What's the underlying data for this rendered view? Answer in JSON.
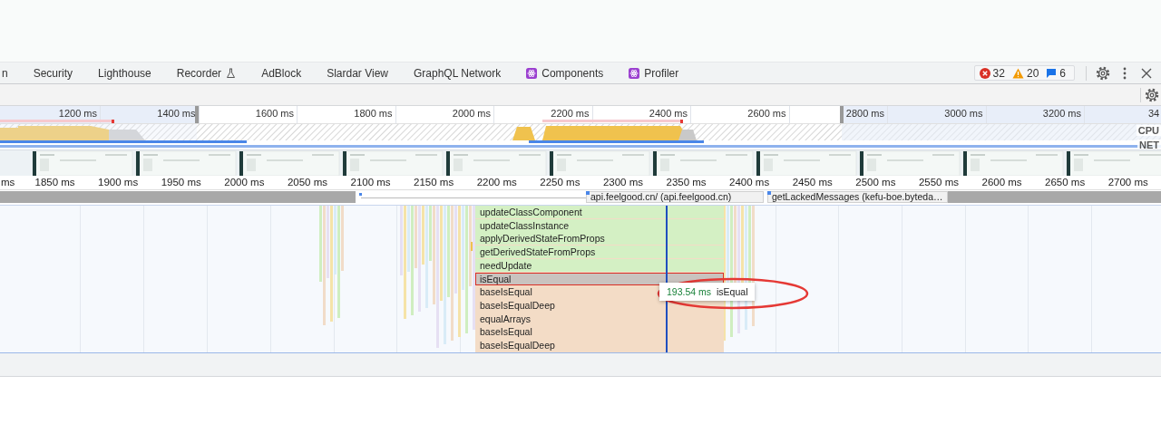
{
  "tabs": [
    {
      "label": "n",
      "selected": false
    },
    {
      "label": "Security",
      "selected": false
    },
    {
      "label": "Lighthouse",
      "selected": false
    },
    {
      "label": "Recorder",
      "selected": false
    },
    {
      "label": "AdBlock",
      "selected": false
    },
    {
      "label": "Slardar View",
      "selected": false
    },
    {
      "label": "GraphQL Network",
      "selected": false
    },
    {
      "label": "Components",
      "selected": false
    },
    {
      "label": "Profiler",
      "selected": false
    }
  ],
  "counters": [
    {
      "kind": "error",
      "count": "32"
    },
    {
      "kind": "warning",
      "count": "20"
    },
    {
      "kind": "info",
      "count": "6"
    }
  ],
  "overview": {
    "ticks": [
      "1200 ms",
      "1400 ms",
      "1600 ms",
      "1800 ms",
      "2000 ms",
      "2200 ms",
      "2400 ms",
      "2600 ms",
      "2800 ms",
      "3000 ms",
      "3200 ms",
      "34"
    ],
    "track_labels": [
      "CPU",
      "NET"
    ]
  },
  "detail_ruler": {
    "ticks": [
      "ms",
      "1850 ms",
      "1900 ms",
      "1950 ms",
      "2000 ms",
      "2050 ms",
      "2100 ms",
      "2150 ms",
      "2200 ms",
      "2250 ms",
      "2300 ms",
      "2350 ms",
      "2400 ms",
      "2450 ms",
      "2500 ms",
      "2550 ms",
      "2600 ms",
      "2650 ms",
      "2700 ms"
    ]
  },
  "network_requests": [
    {
      "label": "api.feelgood.cn/ (api.feelgood.cn)"
    },
    {
      "label": "getLackedMessages (kefu-boe.byteda…"
    }
  ],
  "flame_chart": {
    "entries": [
      {
        "name": "updateClassComponent",
        "color": "#d4f0c4",
        "selected": false
      },
      {
        "name": "updateClassInstance",
        "color": "#d4f0c4",
        "selected": false
      },
      {
        "name": "applyDerivedStateFromProps",
        "color": "#d4f0c4",
        "selected": false
      },
      {
        "name": "getDerivedStateFromProps",
        "color": "#d4f0c4",
        "selected": false
      },
      {
        "name": "needUpdate",
        "color": "#d4f0c4",
        "selected": false
      },
      {
        "name": "isEqual",
        "color": "#c9c3bf",
        "selected": true
      },
      {
        "name": "baseIsEqual",
        "color": "#f3dcc6",
        "selected": false
      },
      {
        "name": "baseIsEqualDeep",
        "color": "#f3dcc6",
        "selected": false
      },
      {
        "name": "equalArrays",
        "color": "#f3dcc6",
        "selected": false
      },
      {
        "name": "baseIsEqual",
        "color": "#f3dcc6",
        "selected": false
      },
      {
        "name": "baseIsEqualDeep",
        "color": "#f3dcc6",
        "selected": false
      }
    ],
    "tooltip": {
      "duration": "193.54 ms",
      "name": "isEqual"
    }
  }
}
